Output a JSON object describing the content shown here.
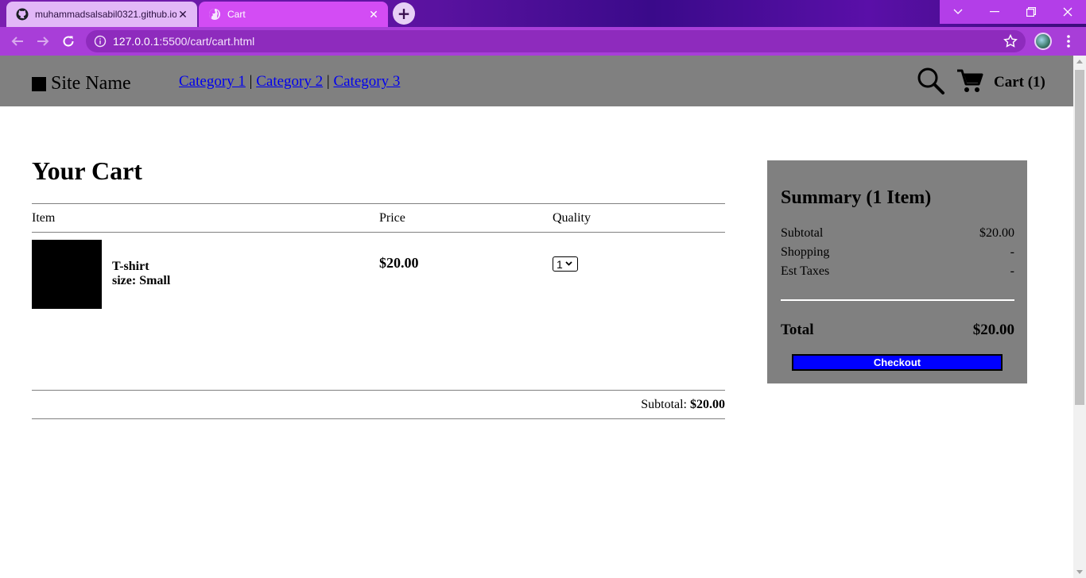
{
  "browser": {
    "tabs": [
      {
        "title": "muhammadsalsabil0321.github.io",
        "active": false
      },
      {
        "title": "Cart",
        "active": true
      }
    ],
    "new_tab_icon": "plus-icon",
    "url_host": "127.0.0.1",
    "url_path": ":5500/cart/cart.html",
    "theme_color": "#a83ed8"
  },
  "site": {
    "name": "Site Name",
    "categories": [
      "Category 1",
      "Category 2",
      "Category 3"
    ],
    "separator": "|",
    "cart_label": "Cart (1)"
  },
  "cart": {
    "title": "Your Cart",
    "columns": {
      "item": "Item",
      "price": "Price",
      "quantity": "Quality"
    },
    "items": [
      {
        "name": "T-shirt",
        "size": "size: Small",
        "price": "$20.00",
        "qty": "1"
      }
    ],
    "subtotal_label": "Subtotal:",
    "subtotal_value": "$20.00"
  },
  "summary": {
    "title": "Summary (1 Item)",
    "rows": [
      {
        "label": "Subtotal",
        "value": "$20.00"
      },
      {
        "label": "Shopping",
        "value": "-"
      },
      {
        "label": "Est Taxes",
        "value": "-"
      }
    ],
    "total_label": "Total",
    "total_value": "$20.00",
    "checkout_label": "Checkout",
    "panel_color": "#808080",
    "checkout_color": "#0000ff"
  }
}
